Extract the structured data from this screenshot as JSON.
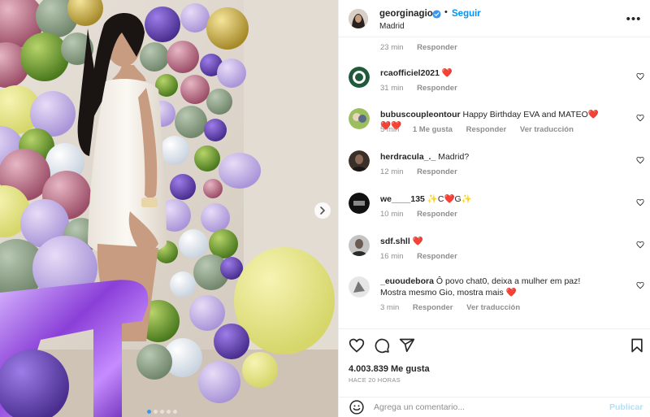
{
  "post": {
    "username": "georginagio",
    "follow_label": "Seguir",
    "separator": "•",
    "location": "Madrid",
    "more_label": "•••"
  },
  "top_partial": {
    "time": "23 min",
    "reply": "Responder"
  },
  "comments": [
    {
      "user": "rcaofficiel2021",
      "text": "❤️",
      "time": "31 min",
      "likes": "",
      "reply": "Responder",
      "translation": ""
    },
    {
      "user": "bubuscoupleontour",
      "text": "Happy Birthday EVA and MATEO❤️❤️❤️",
      "time": "5 min",
      "likes": "1 Me gusta",
      "reply": "Responder",
      "translation": "Ver traducción"
    },
    {
      "user": "herdracula_._",
      "text": "Madrid?",
      "time": "12 min",
      "likes": "",
      "reply": "Responder",
      "translation": ""
    },
    {
      "user": "we____135",
      "text": "✨C❤️G✨",
      "time": "10 min",
      "likes": "",
      "reply": "Responder",
      "translation": ""
    },
    {
      "user": "sdf.shll",
      "text": "❤️",
      "time": "16 min",
      "likes": "",
      "reply": "Responder",
      "translation": ""
    },
    {
      "user": "_euoudebora",
      "text": "Ô povo chat0, deixa a mulher em paz! Mostra mesmo Gio, mostra mais ❤️",
      "time": "3 min",
      "likes": "",
      "reply": "Responder",
      "translation": "Ver traducción"
    }
  ],
  "stats": {
    "likes": "4.003.839 Me gusta",
    "time_ago": "HACE 20 HORAS"
  },
  "add_comment": {
    "placeholder": "Agrega un comentario...",
    "publish_label": "Publicar"
  },
  "colors": {
    "accent": "#0095f6",
    "verified": "#3897f0",
    "muted": "#8e8e8e",
    "publish_disabled": "#b2dffc",
    "heart": "#ed4956"
  },
  "carousel": {
    "slide_count": 5,
    "active_index": 0
  }
}
